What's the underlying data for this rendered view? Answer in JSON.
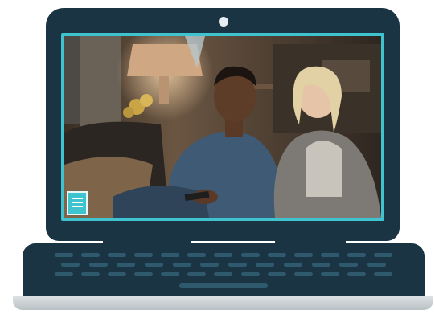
{
  "colors": {
    "laptop_body": "#1b3443",
    "screen_border": "#3fc3cf",
    "key": "#2f5a6e",
    "base_lip": "#c9ced1"
  },
  "screen": {
    "content": "video-frame"
  },
  "icons": [
    "webcam-icon",
    "channel-logo-icon"
  ]
}
